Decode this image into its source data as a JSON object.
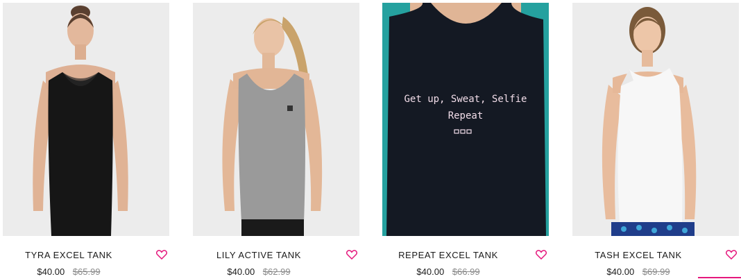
{
  "theme": {
    "accent": "#e5177c",
    "photo_bg": "#ececec"
  },
  "products": [
    {
      "name": "TYRA EXCEL TANK",
      "price": "$40.00",
      "original_price": "$65.99",
      "tank_color": "#161616",
      "wishlist_icon": "heart-outline-icon"
    },
    {
      "name": "LILY ACTIVE TANK",
      "price": "$40.00",
      "original_price": "$62.99",
      "tank_color": "#9a9a9a",
      "wishlist_icon": "heart-outline-icon"
    },
    {
      "name": "REPEAT EXCEL TANK",
      "price": "$40.00",
      "original_price": "$66.99",
      "tank_color": "#141923",
      "print_line1": "Get up, Sweat, Selfie",
      "print_line2": "Repeat",
      "wishlist_icon": "heart-outline-icon"
    },
    {
      "name": "TASH EXCEL TANK",
      "price": "$40.00",
      "original_price": "$69.99",
      "tank_color": "#f7f7f7",
      "wishlist_icon": "heart-outline-icon"
    }
  ]
}
